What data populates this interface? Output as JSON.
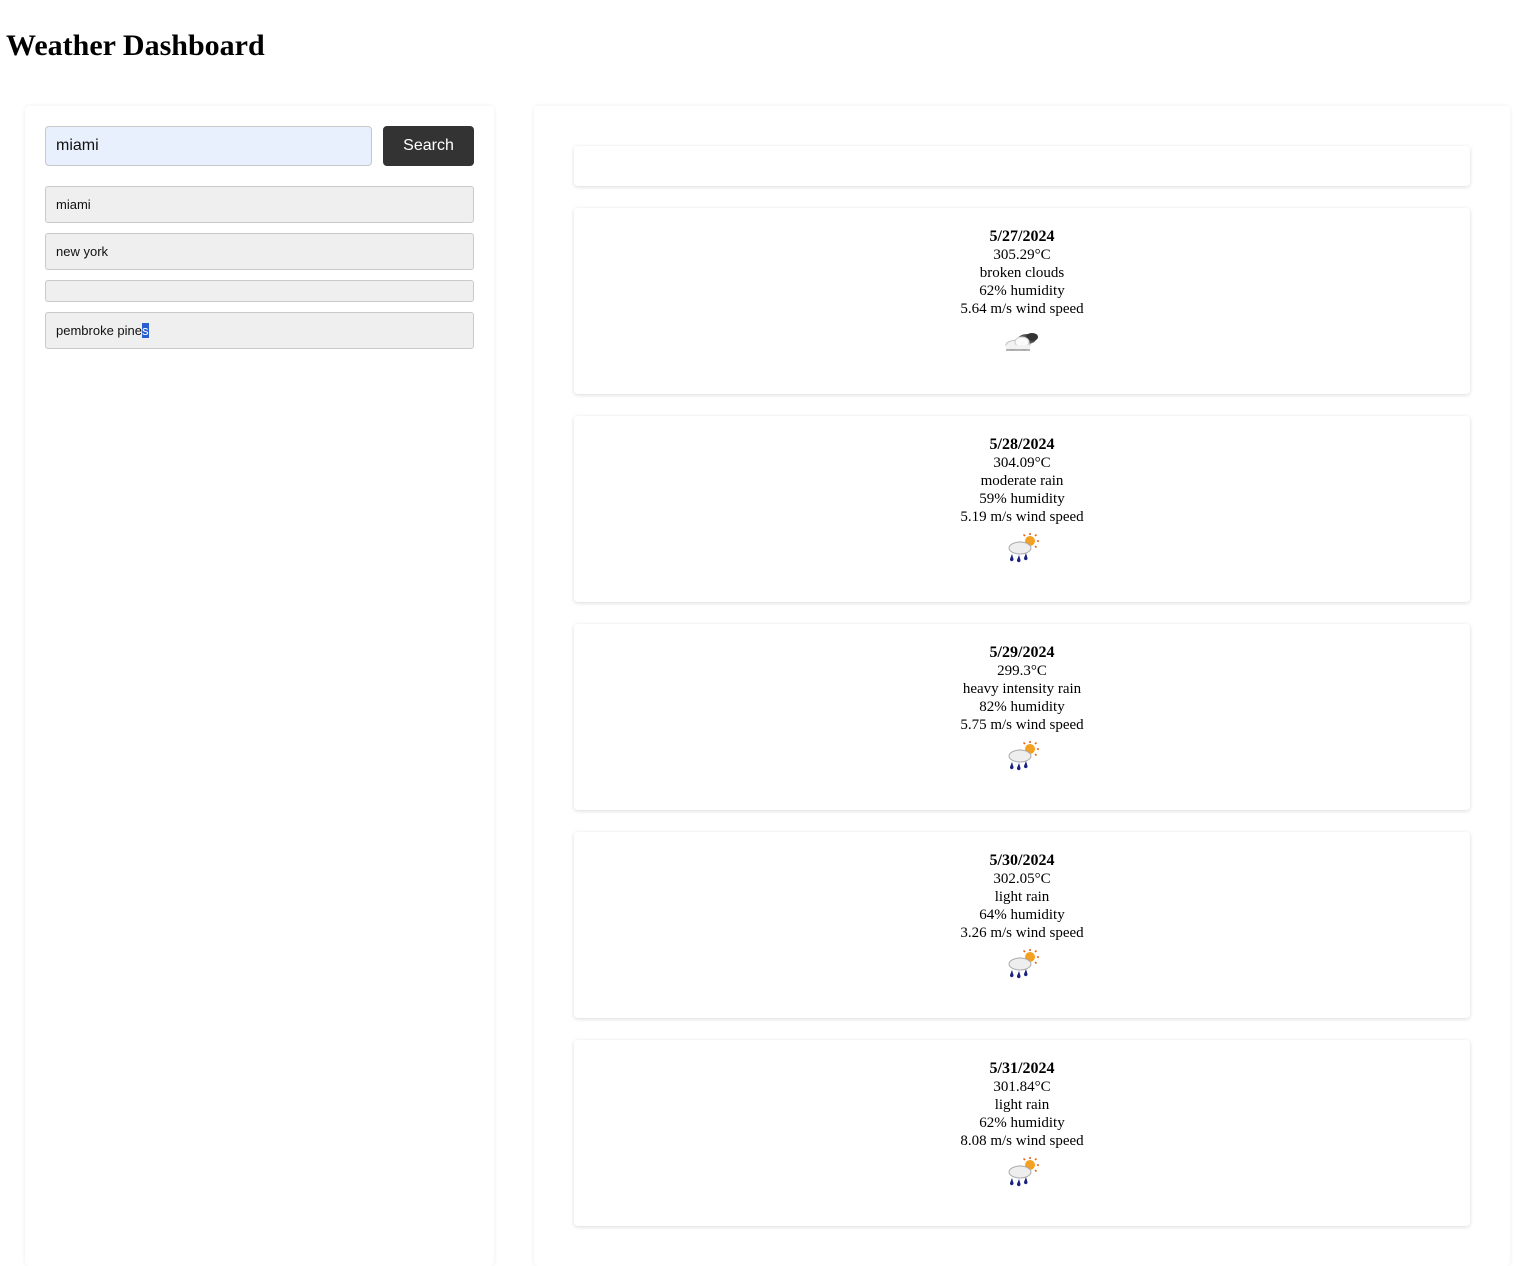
{
  "header": {
    "title": "Weather Dashboard"
  },
  "search": {
    "value": "miami",
    "button_label": "Search"
  },
  "history": [
    {
      "label": "miami"
    },
    {
      "label": "new york"
    },
    {
      "label": ""
    },
    {
      "label_main": "pembroke pine",
      "label_selected": "s"
    }
  ],
  "forecast": [
    {
      "date": "5/27/2024",
      "temp": "305.29°C",
      "desc": "broken clouds",
      "humidity": "62% humidity",
      "wind": "5.64 m/s wind speed",
      "icon": "broken-clouds-icon"
    },
    {
      "date": "5/28/2024",
      "temp": "304.09°C",
      "desc": "moderate rain",
      "humidity": "59% humidity",
      "wind": "5.19 m/s wind speed",
      "icon": "rain-sun-icon"
    },
    {
      "date": "5/29/2024",
      "temp": "299.3°C",
      "desc": "heavy intensity rain",
      "humidity": "82% humidity",
      "wind": "5.75 m/s wind speed",
      "icon": "rain-sun-icon"
    },
    {
      "date": "5/30/2024",
      "temp": "302.05°C",
      "desc": "light rain",
      "humidity": "64% humidity",
      "wind": "3.26 m/s wind speed",
      "icon": "rain-sun-icon"
    },
    {
      "date": "5/31/2024",
      "temp": "301.84°C",
      "desc": "light rain",
      "humidity": "62% humidity",
      "wind": "8.08 m/s wind speed",
      "icon": "rain-sun-icon"
    }
  ],
  "colors": {
    "button_bg": "#333333",
    "input_bg": "#e8f0fe",
    "history_bg": "#efefef",
    "selection": "#2a5fd0"
  }
}
